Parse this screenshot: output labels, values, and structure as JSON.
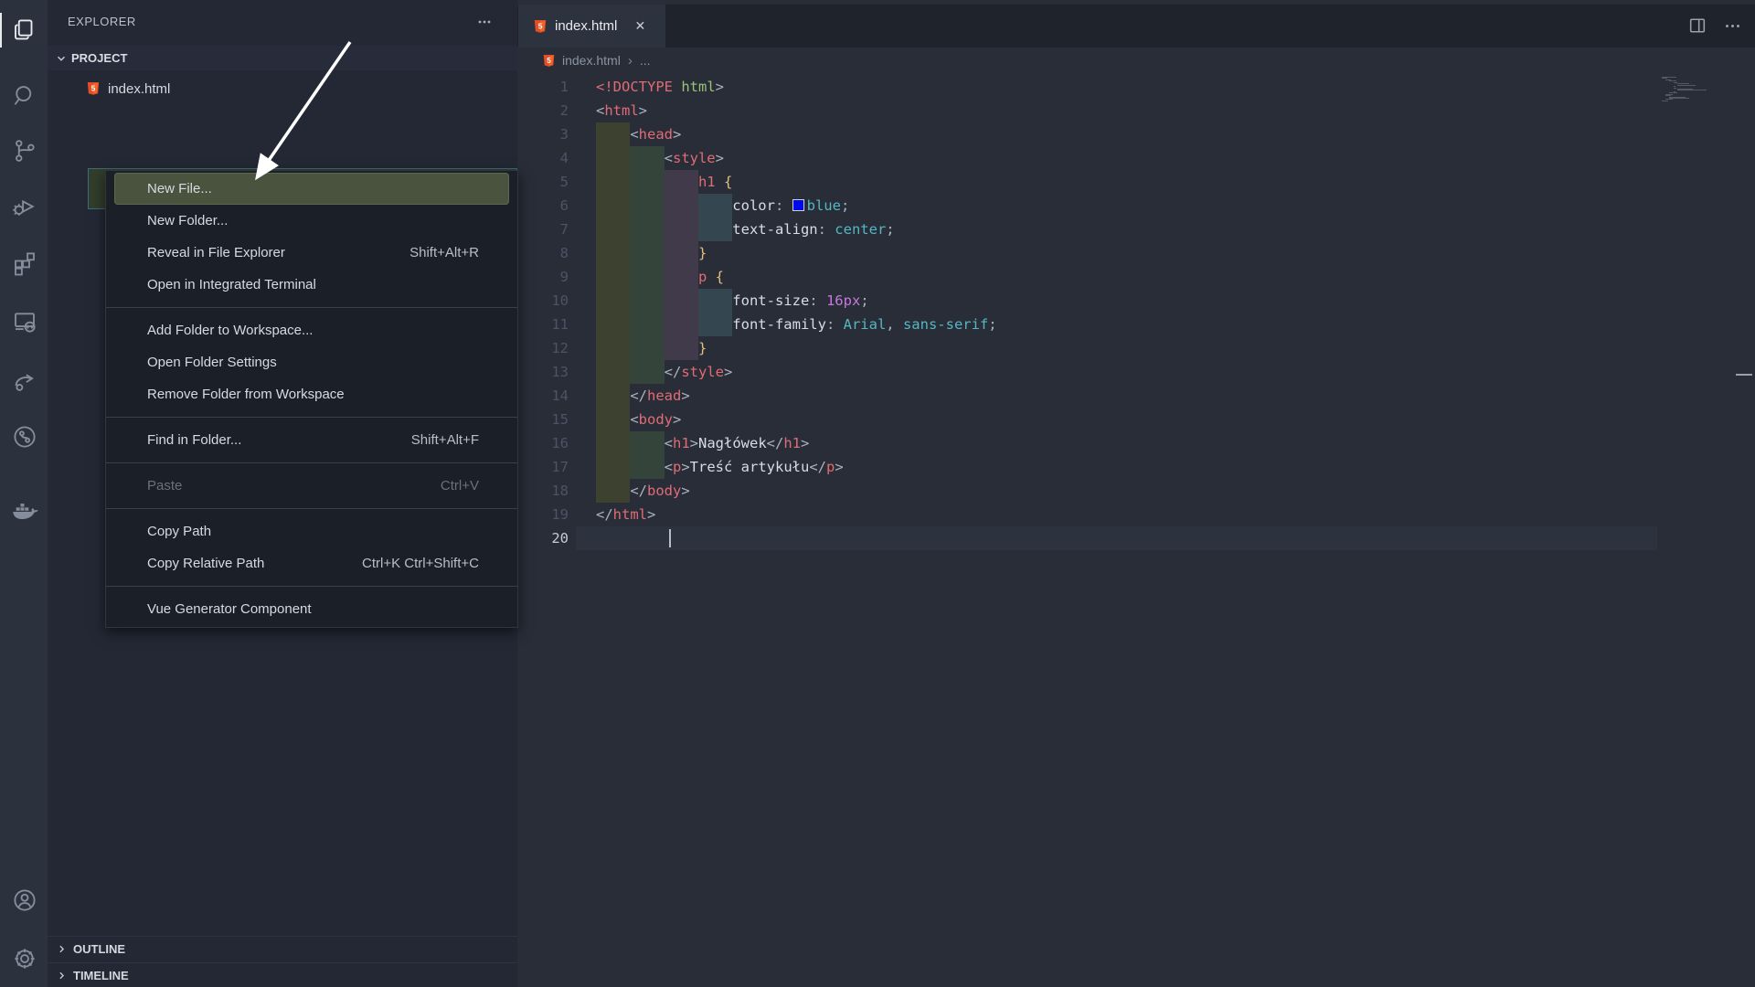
{
  "activity_bar": {
    "icons": [
      {
        "name": "explorer-icon",
        "active": true
      },
      {
        "name": "search-icon"
      },
      {
        "name": "source-control-icon"
      },
      {
        "name": "run-debug-icon"
      },
      {
        "name": "extensions-icon"
      },
      {
        "name": "remote-explorer-icon"
      },
      {
        "name": "live-share-icon"
      },
      {
        "name": "git-graph-icon"
      },
      {
        "name": "docker-icon"
      },
      {
        "name": "account-icon"
      },
      {
        "name": "settings-gear-icon"
      }
    ]
  },
  "explorer": {
    "title": "EXPLORER",
    "project_label": "PROJECT",
    "files": [
      {
        "name": "index.html",
        "icon": "html5-file-icon"
      }
    ],
    "outline_label": "OUTLINE",
    "timeline_label": "TIMELINE"
  },
  "context_menu": {
    "groups": [
      [
        {
          "label": "New File...",
          "highlighted": true
        },
        {
          "label": "New Folder..."
        },
        {
          "label": "Reveal in File Explorer",
          "shortcut": "Shift+Alt+R"
        },
        {
          "label": "Open in Integrated Terminal"
        }
      ],
      [
        {
          "label": "Add Folder to Workspace..."
        },
        {
          "label": "Open Folder Settings"
        },
        {
          "label": "Remove Folder from Workspace"
        }
      ],
      [
        {
          "label": "Find in Folder...",
          "shortcut": "Shift+Alt+F"
        }
      ],
      [
        {
          "label": "Paste",
          "shortcut": "Ctrl+V",
          "disabled": true
        }
      ],
      [
        {
          "label": "Copy Path"
        },
        {
          "label": "Copy Relative Path",
          "shortcut": "Ctrl+K Ctrl+Shift+C"
        }
      ],
      [
        {
          "label": "Vue Generator Component"
        }
      ]
    ]
  },
  "editor": {
    "tab": {
      "label": "index.html",
      "icon": "html5-file-icon",
      "close": "✕"
    },
    "breadcrumb": {
      "file": "index.html",
      "more": "..."
    },
    "code": {
      "language": "html",
      "lines": [
        {
          "ind": 0,
          "tokens": [
            {
              "k": "tag",
              "t": "<!DOCTYPE"
            },
            {
              "k": "punct",
              "t": " "
            },
            {
              "k": "green",
              "t": "html"
            },
            {
              "k": "punct",
              "t": ">"
            }
          ]
        },
        {
          "ind": 0,
          "tokens": [
            {
              "k": "punct",
              "t": "<"
            },
            {
              "k": "tag",
              "t": "html"
            },
            {
              "k": "punct",
              "t": ">"
            }
          ]
        },
        {
          "ind": 4,
          "tokens": [
            {
              "k": "punct",
              "t": "<"
            },
            {
              "k": "tag",
              "t": "head"
            },
            {
              "k": "punct",
              "t": ">"
            }
          ]
        },
        {
          "ind": 8,
          "tokens": [
            {
              "k": "punct",
              "t": "<"
            },
            {
              "k": "tag",
              "t": "style"
            },
            {
              "k": "punct",
              "t": ">"
            }
          ]
        },
        {
          "ind": 12,
          "tokens": [
            {
              "k": "tag",
              "t": "h1"
            },
            {
              "k": "punct",
              "t": " "
            },
            {
              "k": "brace",
              "t": "{"
            }
          ]
        },
        {
          "ind": 16,
          "tokens": [
            {
              "k": "prop",
              "t": "color"
            },
            {
              "k": "punct",
              "t": ": "
            },
            {
              "k": "swatch",
              "t": ""
            },
            {
              "k": "value",
              "t": "blue"
            },
            {
              "k": "punct",
              "t": ";"
            }
          ]
        },
        {
          "ind": 16,
          "tokens": [
            {
              "k": "prop",
              "t": "text-align"
            },
            {
              "k": "punct",
              "t": ": "
            },
            {
              "k": "value",
              "t": "center"
            },
            {
              "k": "punct",
              "t": ";"
            }
          ]
        },
        {
          "ind": 12,
          "tokens": [
            {
              "k": "brace",
              "t": "}"
            }
          ]
        },
        {
          "ind": 12,
          "tokens": [
            {
              "k": "tag",
              "t": "p"
            },
            {
              "k": "punct",
              "t": " "
            },
            {
              "k": "brace",
              "t": "{"
            }
          ]
        },
        {
          "ind": 16,
          "tokens": [
            {
              "k": "prop",
              "t": "font-size"
            },
            {
              "k": "punct",
              "t": ": "
            },
            {
              "k": "num",
              "t": "16px"
            },
            {
              "k": "punct",
              "t": ";"
            }
          ]
        },
        {
          "ind": 16,
          "tokens": [
            {
              "k": "prop",
              "t": "font-family"
            },
            {
              "k": "punct",
              "t": ": "
            },
            {
              "k": "value",
              "t": "Arial"
            },
            {
              "k": "punct",
              "t": ", "
            },
            {
              "k": "value",
              "t": "sans-serif"
            },
            {
              "k": "punct",
              "t": ";"
            }
          ]
        },
        {
          "ind": 12,
          "tokens": [
            {
              "k": "brace",
              "t": "}"
            }
          ]
        },
        {
          "ind": 8,
          "tokens": [
            {
              "k": "punct",
              "t": "</"
            },
            {
              "k": "tag",
              "t": "style"
            },
            {
              "k": "punct",
              "t": ">"
            }
          ]
        },
        {
          "ind": 4,
          "tokens": [
            {
              "k": "punct",
              "t": "</"
            },
            {
              "k": "tag",
              "t": "head"
            },
            {
              "k": "punct",
              "t": ">"
            }
          ]
        },
        {
          "ind": 4,
          "tokens": [
            {
              "k": "punct",
              "t": "<"
            },
            {
              "k": "tag",
              "t": "body"
            },
            {
              "k": "punct",
              "t": ">"
            }
          ]
        },
        {
          "ind": 8,
          "tokens": [
            {
              "k": "punct",
              "t": "<"
            },
            {
              "k": "tag",
              "t": "h1"
            },
            {
              "k": "punct",
              "t": ">"
            },
            {
              "k": "text",
              "t": "Nagłówek"
            },
            {
              "k": "punct",
              "t": "</"
            },
            {
              "k": "tag",
              "t": "h1"
            },
            {
              "k": "punct",
              "t": ">"
            }
          ]
        },
        {
          "ind": 8,
          "tokens": [
            {
              "k": "punct",
              "t": "<"
            },
            {
              "k": "tag",
              "t": "p"
            },
            {
              "k": "punct",
              "t": ">"
            },
            {
              "k": "text",
              "t": "Treść artykułu"
            },
            {
              "k": "punct",
              "t": "</"
            },
            {
              "k": "tag",
              "t": "p"
            },
            {
              "k": "punct",
              "t": ">"
            }
          ]
        },
        {
          "ind": 4,
          "tokens": [
            {
              "k": "punct",
              "t": "</"
            },
            {
              "k": "tag",
              "t": "body"
            },
            {
              "k": "punct",
              "t": ">"
            }
          ]
        },
        {
          "ind": 0,
          "tokens": [
            {
              "k": "punct",
              "t": "</"
            },
            {
              "k": "tag",
              "t": "html"
            },
            {
              "k": "punct",
              "t": ">"
            }
          ]
        },
        {
          "ind": 0,
          "active": true,
          "tokens": []
        }
      ]
    }
  },
  "colors": {
    "activity_bar_bg": "#2b313d",
    "sidebar_bg": "#232834",
    "editor_bg": "#282d38",
    "menu_bg": "#1b1f27",
    "menu_highlight_green": "#49533d",
    "drop_band_green": "#323d2b",
    "drop_band_border": "#3c6b7a",
    "html_icon_orange": "#e44d26",
    "tag_red": "#e06c75",
    "value_cyan": "#56b6c2",
    "number_magenta": "#c678dd",
    "brace_yellow": "#e5c07b",
    "attr_green": "#98c379",
    "swatch_blue": "#0008ee",
    "annotation_arrow": "#ffffff"
  },
  "annotation": {
    "type": "arrow",
    "points_at": "New File..."
  }
}
